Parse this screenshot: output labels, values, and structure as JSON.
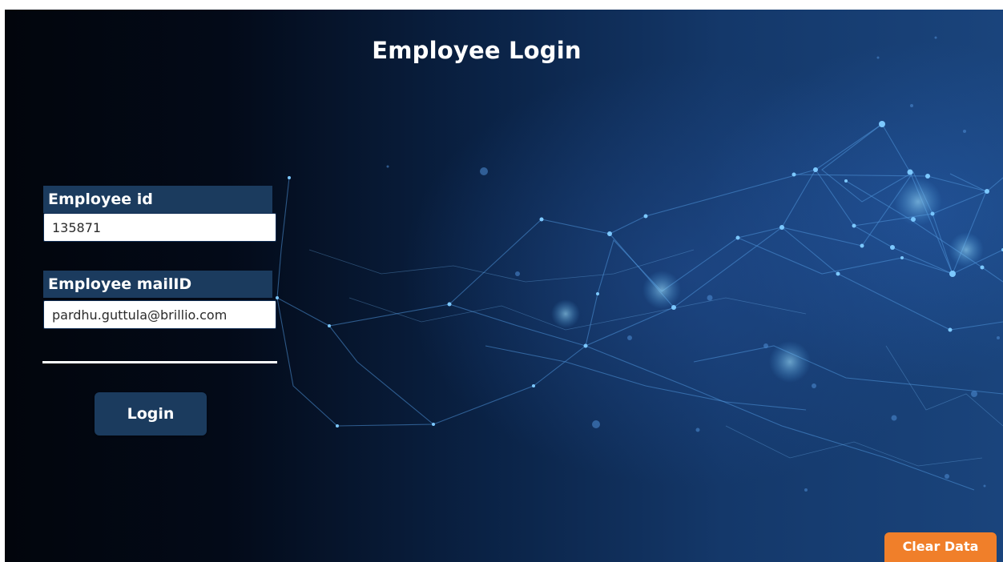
{
  "page": {
    "title": "Employee Login"
  },
  "form": {
    "employee_id_label": "Employee id",
    "employee_id_value": "135871",
    "employee_mail_label": "Employee mailID",
    "employee_mail_value": "pardhu.guttula@brillio.com",
    "login_label": "Login"
  },
  "actions": {
    "clear_label": "Clear Data"
  },
  "colors": {
    "label_background": "#1b3b5e",
    "button_background": "#1b3b5e",
    "clear_button": "#f07f2a",
    "background_dark": "#02050c",
    "background_blue": "#1a447c"
  }
}
